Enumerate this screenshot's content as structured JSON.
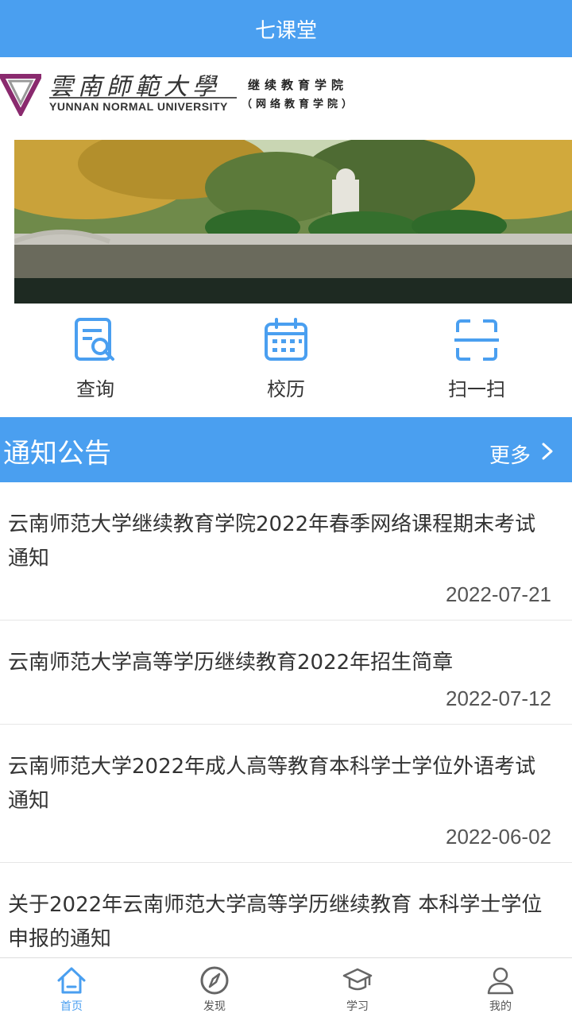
{
  "app": {
    "title": "七课堂"
  },
  "logo": {
    "calligraphy": "雲南師範大學",
    "english": "YUNNAN NORMAL UNIVERSITY",
    "cn_line1": "继续教育学院",
    "cn_line2": "（网络教育学院）"
  },
  "quick_actions": [
    {
      "label": "查询",
      "icon": "search-document-icon"
    },
    {
      "label": "校历",
      "icon": "calendar-icon"
    },
    {
      "label": "扫一扫",
      "icon": "scan-icon"
    }
  ],
  "notices": {
    "title": "通知公告",
    "more_label": "更多",
    "items": [
      {
        "title": "云南师范大学继续教育学院2022年春季网络课程期末考试通知",
        "date": "2022-07-21"
      },
      {
        "title": "云南师范大学高等学历继续教育2022年招生简章",
        "date": "2022-07-12"
      },
      {
        "title": "云南师范大学2022年成人高等教育本科学士学位外语考试通知",
        "date": "2022-06-02"
      },
      {
        "title": "关于2022年云南师范大学高等学历继续教育 本科学士学位申报的通知",
        "date": ""
      }
    ]
  },
  "tabbar": {
    "items": [
      {
        "label": "首页",
        "icon": "home-icon",
        "active": true
      },
      {
        "label": "发现",
        "icon": "compass-icon",
        "active": false
      },
      {
        "label": "学习",
        "icon": "graduation-cap-icon",
        "active": false
      },
      {
        "label": "我的",
        "icon": "user-icon",
        "active": false
      }
    ]
  },
  "colors": {
    "primary": "#4a9ff0"
  }
}
